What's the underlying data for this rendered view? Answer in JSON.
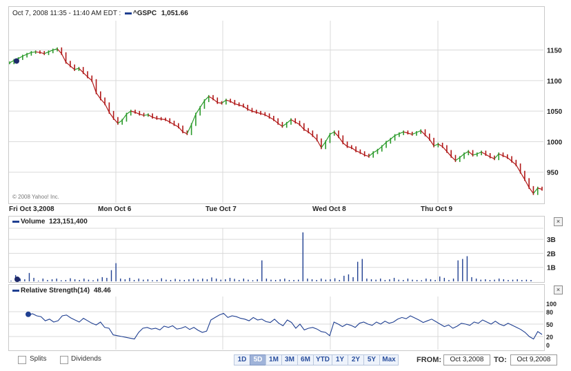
{
  "header": {
    "timestamp": "Oct 7, 2008 11:35 - 11:40 AM EDT :",
    "symbol": "^GSPC",
    "value": "1,051.66"
  },
  "copyright": "© 2008 Yahoo! Inc.",
  "days": [
    "Fri Oct 3,2008",
    "Mon Oct 6",
    "Tue Oct 7",
    "Wed Oct 8",
    "Thu Oct 9"
  ],
  "volume": {
    "label": "Volume",
    "value": "123,151,400"
  },
  "rsi": {
    "label": "Relative Strength(14)",
    "value": "48.46"
  },
  "options": {
    "splits": "Splits",
    "dividends": "Dividends"
  },
  "ranges": [
    "1D",
    "5D",
    "1M",
    "3M",
    "6M",
    "YTD",
    "1Y",
    "2Y",
    "5Y",
    "Max"
  ],
  "selected_range": "5D",
  "from": {
    "label": "FROM:",
    "value": "Oct 3,2008"
  },
  "to": {
    "label": "TO:",
    "value": "Oct 9,2008"
  },
  "colors": {
    "up": "#2a9a2a",
    "down": "#b01717",
    "series": "#1f3f91",
    "grid": "#d9d9d9"
  },
  "chart_data": [
    {
      "type": "line",
      "title": "^GSPC",
      "x": [
        "Fri Oct 3,2008",
        "Mon Oct 6",
        "Tue Oct 7",
        "Wed Oct 8",
        "Thu Oct 9"
      ],
      "y_ticks": [
        950,
        1000,
        1050,
        1100,
        1150
      ],
      "ylim": [
        900,
        1198
      ],
      "series": [
        {
          "name": "^GSPC",
          "values": [
            1129,
            1133,
            1136,
            1140,
            1143,
            1146,
            1147,
            1146,
            1144,
            1147,
            1150,
            1152,
            1144,
            1130,
            1124,
            1118,
            1120,
            1113,
            1106,
            1100,
            1080,
            1070,
            1062,
            1048,
            1038,
            1030,
            1035,
            1045,
            1050,
            1048,
            1045,
            1043,
            1044,
            1040,
            1038,
            1037,
            1036,
            1032,
            1028,
            1024,
            1016,
            1013,
            1028,
            1045,
            1056,
            1067,
            1074,
            1070,
            1064,
            1063,
            1068,
            1066,
            1062,
            1060,
            1058,
            1053,
            1050,
            1048,
            1046,
            1044,
            1040,
            1036,
            1030,
            1025,
            1030,
            1036,
            1032,
            1028,
            1020,
            1016,
            1010,
            1003,
            990,
            1000,
            1012,
            1016,
            1008,
            998,
            992,
            990,
            985,
            982,
            978,
            976,
            982,
            986,
            992,
            999,
            1004,
            1010,
            1013,
            1016,
            1014,
            1012,
            1015,
            1018,
            1011,
            1004,
            993,
            996,
            992,
            984,
            976,
            969,
            974,
            980,
            984,
            978,
            980,
            983,
            979,
            975,
            972,
            980,
            977,
            974,
            968,
            962,
            950,
            938,
            925,
            915,
            924,
            922
          ]
        }
      ]
    },
    {
      "type": "bar",
      "title": "Volume",
      "y_ticks": [
        "1B",
        "2B",
        "3B"
      ],
      "ylim": [
        0,
        3.5
      ],
      "series": [
        {
          "name": "Volume",
          "values": [
            0.05,
            0.45,
            0.2,
            0.15,
            0.6,
            0.25,
            0.05,
            0.2,
            0.1,
            0.15,
            0.2,
            0.08,
            0.1,
            0.22,
            0.15,
            0.1,
            0.2,
            0.12,
            0.08,
            0.18,
            0.3,
            0.25,
            0.8,
            1.3,
            0.2,
            0.15,
            0.25,
            0.1,
            0.2,
            0.12,
            0.15,
            0.08,
            0.1,
            0.22,
            0.12,
            0.1,
            0.18,
            0.12,
            0.1,
            0.15,
            0.2,
            0.12,
            0.2,
            0.15,
            0.28,
            0.2,
            0.12,
            0.15,
            0.25,
            0.18,
            0.1,
            0.2,
            0.12,
            0.08,
            0.15,
            1.5,
            0.2,
            0.12,
            0.1,
            0.15,
            0.2,
            0.1,
            0.1,
            0.12,
            3.5,
            0.2,
            0.15,
            0.1,
            0.2,
            0.12,
            0.15,
            0.22,
            0.1,
            0.4,
            0.5,
            0.3,
            1.4,
            1.6,
            0.2,
            0.15,
            0.12,
            0.2,
            0.1,
            0.15,
            0.25,
            0.12,
            0.1,
            0.2,
            0.12,
            0.1,
            0.08,
            0.2,
            0.15,
            0.1,
            0.35,
            0.25,
            0.1,
            0.2,
            1.5,
            1.6,
            1.8,
            0.3,
            0.2,
            0.12,
            0.15,
            0.1,
            0.12,
            0.2,
            0.15,
            0.1,
            0.12,
            0.15,
            0.1,
            0.12,
            0.1
          ]
        }
      ]
    },
    {
      "type": "line",
      "title": "Relative Strength(14)",
      "y_ticks": [
        0,
        20,
        50,
        80,
        100
      ],
      "ylim": [
        0,
        100
      ],
      "series": [
        {
          "name": "Relative Strength(14)",
          "values": [
            72,
            75,
            70,
            68,
            58,
            62,
            55,
            58,
            70,
            72,
            65,
            60,
            55,
            64,
            58,
            52,
            48,
            55,
            42,
            40,
            24,
            22,
            20,
            18,
            16,
            14,
            30,
            40,
            42,
            38,
            40,
            36,
            45,
            42,
            46,
            38,
            40,
            44,
            37,
            42,
            35,
            30,
            33,
            60,
            66,
            72,
            76,
            66,
            70,
            68,
            64,
            62,
            58,
            66,
            60,
            62,
            56,
            54,
            62,
            52,
            46,
            60,
            54,
            40,
            50,
            36,
            40,
            42,
            38,
            32,
            30,
            22,
            55,
            50,
            44,
            50,
            47,
            42,
            52,
            55,
            50,
            47,
            55,
            50,
            57,
            52,
            55,
            62,
            66,
            63,
            70,
            65,
            60,
            54,
            58,
            62,
            56,
            50,
            44,
            48,
            40,
            45,
            52,
            50,
            47,
            55,
            52,
            60,
            55,
            50,
            57,
            50,
            46,
            52,
            47,
            42,
            37,
            30,
            20,
            14,
            32,
            25
          ]
        }
      ]
    }
  ]
}
